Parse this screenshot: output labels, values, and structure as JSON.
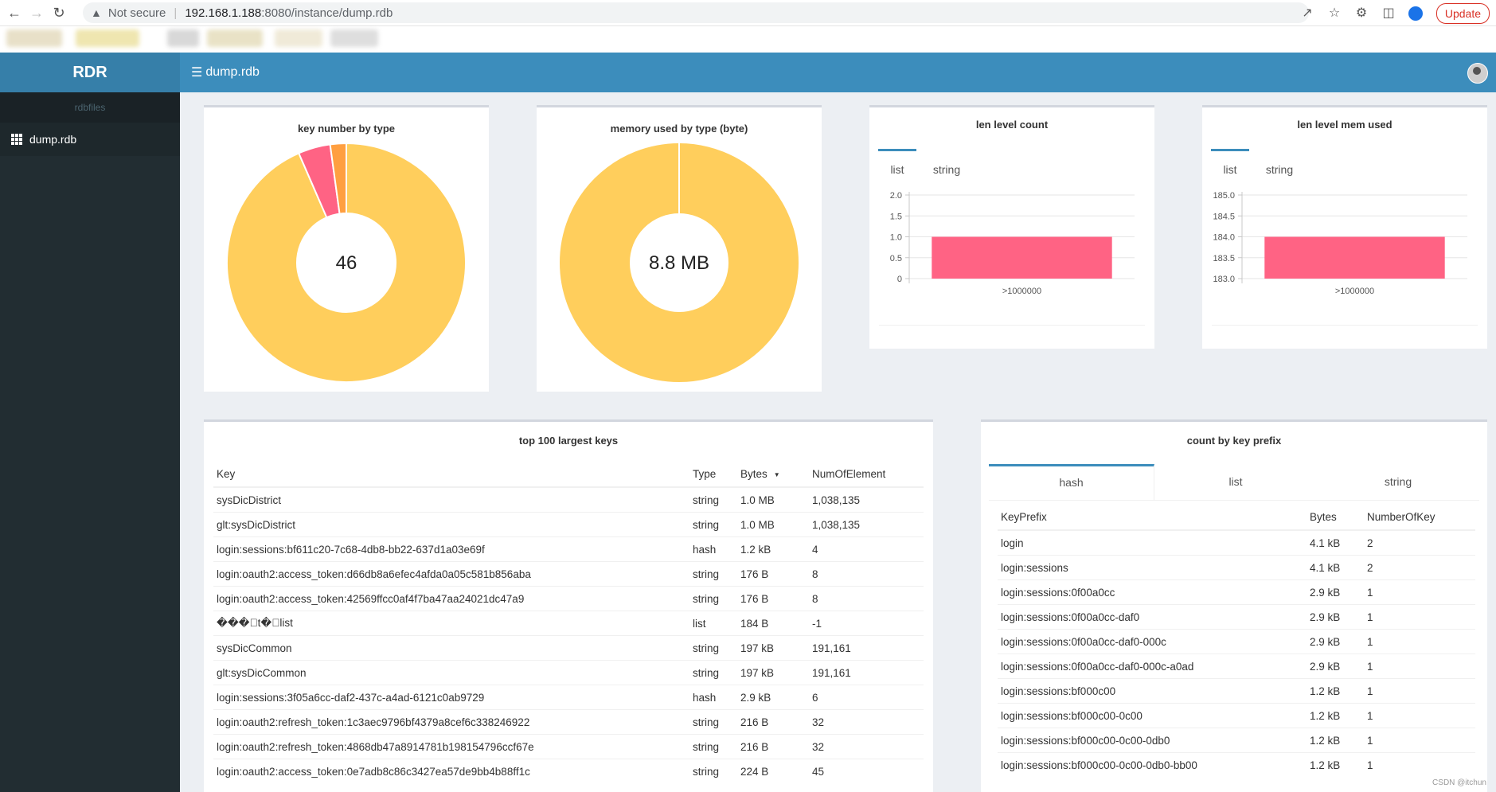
{
  "browser": {
    "not_secure": "Not secure",
    "url_host": "192.168.1.188",
    "url_rest": ":8080/instance/dump.rdb",
    "update_label": "Update"
  },
  "header": {
    "brand": "RDR",
    "page_title": "dump.rdb"
  },
  "sidebar": {
    "section_title": "rdbfiles",
    "items": [
      {
        "label": "dump.rdb"
      }
    ]
  },
  "colors": {
    "accent": "#3c8dbc",
    "sidebar": "#222d32",
    "yellow": "#ffce5c",
    "pink": "#ff6384",
    "orange": "#ff9f40"
  },
  "charts": {
    "key_number": {
      "title": "key number by type",
      "center": "46",
      "chart_data": {
        "type": "pie",
        "values": [
          43,
          2,
          1
        ],
        "colors": [
          "#ffce5c",
          "#ff6384",
          "#ff9f40"
        ]
      }
    },
    "memory_used": {
      "title": "memory used by type (byte)",
      "center": "8.8 MB",
      "chart_data": {
        "type": "pie",
        "values": [
          100
        ],
        "colors": [
          "#ffce5c"
        ]
      }
    },
    "len_level_count": {
      "title": "len level count",
      "tabs": [
        "list",
        "string"
      ],
      "chart_data": {
        "type": "bar",
        "categories": [
          ">1000000"
        ],
        "values": [
          1
        ],
        "ylim": [
          0,
          2
        ],
        "yticks": [
          "2.0",
          "1.5",
          "1.0",
          "0.5",
          "0"
        ]
      }
    },
    "len_level_mem": {
      "title": "len level mem used",
      "tabs": [
        "list",
        "string"
      ],
      "chart_data": {
        "type": "bar",
        "categories": [
          ">1000000"
        ],
        "values": [
          184
        ],
        "ylim": [
          183,
          185
        ],
        "yticks": [
          "185.0",
          "184.5",
          "184.0",
          "183.5",
          "183.0"
        ]
      }
    }
  },
  "largest_keys": {
    "title": "top 100 largest keys",
    "columns": [
      "Key",
      "Type",
      "Bytes",
      "NumOfElement"
    ],
    "rows": [
      [
        "sysDicDistrict",
        "string",
        "1.0 MB",
        "1,038,135"
      ],
      [
        "glt:sysDicDistrict",
        "string",
        "1.0 MB",
        "1,038,135"
      ],
      [
        "login:sessions:bf611c20-7c68-4db8-bb22-637d1a03e69f",
        "hash",
        "1.2 kB",
        "4"
      ],
      [
        "login:oauth2:access_token:d66db8a6efec4afda0a05c581b856aba",
        "string",
        "176 B",
        "8"
      ],
      [
        "login:oauth2:access_token:42569ffcc0af4f7ba47aa24021dc47a9",
        "string",
        "176 B",
        "8"
      ],
      [
        "���\u0000t�\u0000list",
        "list",
        "184 B",
        "-1"
      ],
      [
        "sysDicCommon",
        "string",
        "197 kB",
        "191,161"
      ],
      [
        "glt:sysDicCommon",
        "string",
        "197 kB",
        "191,161"
      ],
      [
        "login:sessions:3f05a6cc-daf2-437c-a4ad-6121c0ab9729",
        "hash",
        "2.9 kB",
        "6"
      ],
      [
        "login:oauth2:refresh_token:1c3aec9796bf4379a8cef6c338246922",
        "string",
        "216 B",
        "32"
      ],
      [
        "login:oauth2:refresh_token:4868db47a8914781b198154796ccf67e",
        "string",
        "216 B",
        "32"
      ],
      [
        "login:oauth2:access_token:0e7adb8c86c3427ea57de9bb4b88ff1c",
        "string",
        "224 B",
        "45"
      ]
    ]
  },
  "key_prefix": {
    "title": "count by key prefix",
    "tabs": [
      "hash",
      "list",
      "string"
    ],
    "columns": [
      "KeyPrefix",
      "Bytes",
      "NumberOfKey"
    ],
    "rows": [
      [
        "login",
        "4.1 kB",
        "2"
      ],
      [
        "login:sessions",
        "4.1 kB",
        "2"
      ],
      [
        "login:sessions:0f00a0cc",
        "2.9 kB",
        "1"
      ],
      [
        "login:sessions:0f00a0cc-daf0",
        "2.9 kB",
        "1"
      ],
      [
        "login:sessions:0f00a0cc-daf0-000c",
        "2.9 kB",
        "1"
      ],
      [
        "login:sessions:0f00a0cc-daf0-000c-a0ad",
        "2.9 kB",
        "1"
      ],
      [
        "login:sessions:bf000c00",
        "1.2 kB",
        "1"
      ],
      [
        "login:sessions:bf000c00-0c00",
        "1.2 kB",
        "1"
      ],
      [
        "login:sessions:bf000c00-0c00-0db0",
        "1.2 kB",
        "1"
      ],
      [
        "login:sessions:bf000c00-0c00-0db0-bb00",
        "1.2 kB",
        "1"
      ]
    ]
  },
  "watermark": "CSDN @itchun"
}
